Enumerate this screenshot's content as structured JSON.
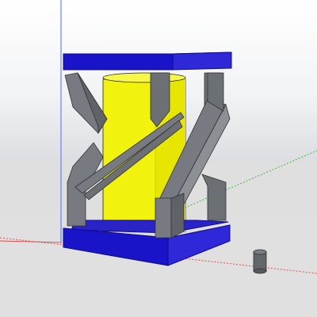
{
  "viewport": {
    "sky_top_color": "#ffffff",
    "sky_horizon_color": "#dcdde0",
    "ground_color": "#e0e0e0"
  },
  "axes": {
    "blue_axis_color": "#4a6cff",
    "green_axis_color": "#38c038",
    "red_axis_color": "#e05050"
  },
  "model": {
    "name_icon": "tower-model-icon",
    "cylinder_color": "#f2f20f",
    "cylinder_shade_color": "#d8d800",
    "plate_color": "#1a14c8",
    "plate_edge_color": "#0f0a90",
    "strut_color": "#777a80",
    "strut_dark_color": "#55585d",
    "strut_light_color": "#9a9da2"
  },
  "small_object": {
    "icon": "small-cylinder-icon",
    "color": "#62666b"
  }
}
